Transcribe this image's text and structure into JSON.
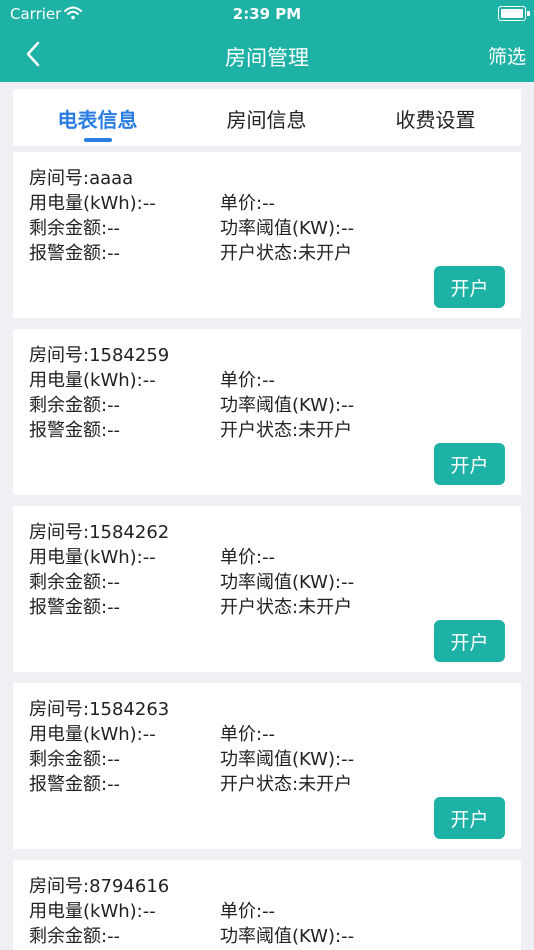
{
  "status_bar": {
    "carrier": "Carrier",
    "time": "2:39 PM"
  },
  "nav": {
    "title": "房间管理",
    "filter_label": "筛选"
  },
  "tabs": [
    {
      "label": "电表信息",
      "active": true
    },
    {
      "label": "房间信息",
      "active": false
    },
    {
      "label": "收费设置",
      "active": false
    }
  ],
  "cards": [
    {
      "room": "房间号:aaaa",
      "usage": "用电量(kWh):--",
      "price": "单价:--",
      "balance": "剩余金额:--",
      "power": "功率阈值(KW):--",
      "alarm": "报警金额:--",
      "account_status": "开户状态:未开户",
      "button": "开户"
    },
    {
      "room": "房间号:1584259",
      "usage": "用电量(kWh):--",
      "price": "单价:--",
      "balance": "剩余金额:--",
      "power": "功率阈值(KW):--",
      "alarm": "报警金额:--",
      "account_status": "开户状态:未开户",
      "button": "开户"
    },
    {
      "room": "房间号:1584262",
      "usage": "用电量(kWh):--",
      "price": "单价:--",
      "balance": "剩余金额:--",
      "power": "功率阈值(KW):--",
      "alarm": "报警金额:--",
      "account_status": "开户状态:未开户",
      "button": "开户"
    },
    {
      "room": "房间号:1584263",
      "usage": "用电量(kWh):--",
      "price": "单价:--",
      "balance": "剩余金额:--",
      "power": "功率阈值(KW):--",
      "alarm": "报警金额:--",
      "account_status": "开户状态:未开户",
      "button": "开户"
    },
    {
      "room": "房间号:8794616",
      "usage": "用电量(kWh):--",
      "price": "单价:--",
      "balance": "剩余金额:--",
      "power": "功率阈值(KW):--"
    }
  ],
  "colors": {
    "header": "#1eb1a6",
    "accent": "#2a7de1",
    "background": "#efeff4"
  }
}
